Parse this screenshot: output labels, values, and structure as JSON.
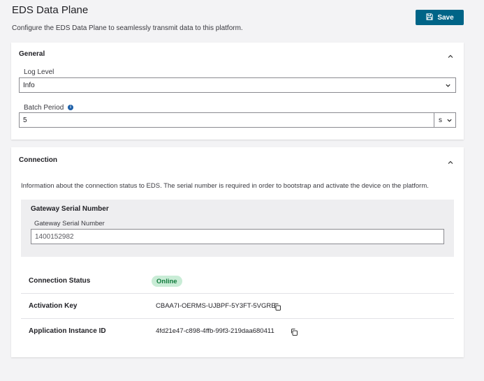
{
  "page": {
    "title": "EDS Data Plane",
    "description": "Configure the EDS Data Plane to seamlessly transmit data to this platform.",
    "save_label": "Save"
  },
  "general": {
    "title": "General",
    "log_level_label": "Log Level",
    "log_level_value": "Info",
    "batch_period_label": "Batch Period",
    "batch_period_value": "5",
    "batch_period_unit": "s"
  },
  "connection": {
    "title": "Connection",
    "info": "Information about the connection status to EDS. The serial number is required in order to bootstrap and activate the device on the platform.",
    "serial_section_title": "Gateway Serial Number",
    "serial_field_label": "Gateway Serial Number",
    "serial_value": "1400152982",
    "rows": [
      {
        "label": "Connection Status",
        "value": "Online"
      },
      {
        "label": "Activation Key",
        "value": "CBAA7I-OERMS-UJBPF-5Y3FT-5VGRE"
      },
      {
        "label": "Application Instance ID",
        "value": "4fd21e47-c898-4ffb-99f3-219daa680411"
      }
    ]
  },
  "colors": {
    "accent": "#006487",
    "status_online_bg": "#c9ecd6",
    "status_online_text": "#107a3c",
    "info_icon": "#1c5fa8"
  },
  "icons": [
    "save-icon",
    "chevron-up-icon",
    "chevron-down-icon",
    "info-icon",
    "copy-icon"
  ]
}
